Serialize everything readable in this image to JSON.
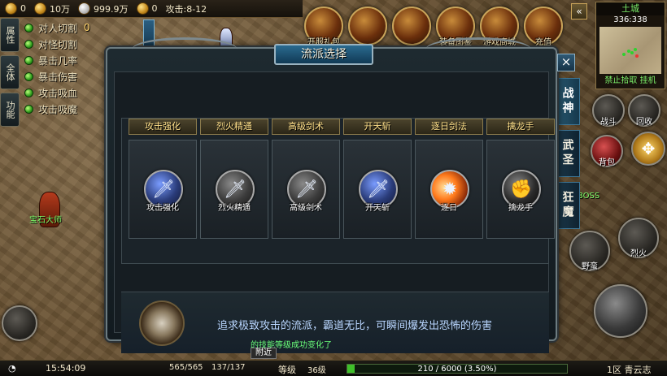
{
  "currency": [
    {
      "icon": "coin-icon",
      "value": "0"
    },
    {
      "icon": "coin-icon",
      "value": "10万"
    },
    {
      "icon": "silver-coin-icon",
      "value": "999.9万"
    },
    {
      "icon": "coin-icon",
      "value": "0"
    }
  ],
  "attack_speed": "攻击:8-12",
  "side_tabs": [
    "属性",
    "全体",
    "功能"
  ],
  "stats": [
    {
      "label": "对人切割",
      "value": "0"
    },
    {
      "label": "对怪切割",
      "value": ""
    },
    {
      "label": "暴击几率",
      "value": ""
    },
    {
      "label": "暴击伤害",
      "value": ""
    },
    {
      "label": "攻击吸血",
      "value": ""
    },
    {
      "label": "攻击吸魔",
      "value": ""
    }
  ],
  "top_icons": [
    "开服礼包",
    "",
    "",
    "装备图鉴",
    "游戏商城",
    "充值"
  ],
  "minimap": {
    "title": "土城",
    "coords": "336:338",
    "footer": "禁止拾取 挂机"
  },
  "dialog": {
    "title": "流派选择",
    "close": "×",
    "skills": [
      {
        "name": "攻击强化",
        "label": "攻击强化",
        "icon": "sword-enhance-icon",
        "variant": "blue"
      },
      {
        "name": "烈火精通",
        "label": "烈火精通",
        "icon": "flame-blade-icon",
        "variant": ""
      },
      {
        "name": "高级剑术",
        "label": "高级剑术",
        "icon": "sword-icon",
        "variant": ""
      },
      {
        "name": "开天斩",
        "label": "开天斩",
        "icon": "heaven-slash-icon",
        "variant": "blue"
      },
      {
        "name": "逐日剑法",
        "label": "逐日",
        "icon": "sun-chase-icon",
        "variant": "fire"
      },
      {
        "name": "擒龙手",
        "label": "擒龙手",
        "icon": "dragon-grab-icon",
        "variant": "shadow"
      }
    ],
    "description": "追求极致攻击的流派，霸道无比，可瞬间爆发出恐怖的伤害"
  },
  "class_tabs": [
    {
      "label": "战神",
      "active": true
    },
    {
      "label": "武圣",
      "active": false
    },
    {
      "label": "狂魔",
      "active": false
    }
  ],
  "right_buttons": {
    "bag": "背包",
    "skill1": "野蛮",
    "skill2": "烈火",
    "boss": "野外BOSS",
    "recycle": "回收",
    "battle": "战斗"
  },
  "npc": "宝石大师",
  "chat": {
    "message": "的技能等级成功变化了",
    "nearby": "附近"
  },
  "bottom": {
    "time": "15:54:09",
    "hp": "565/565",
    "mp": "137/137",
    "level_label": "等级",
    "level": "36级",
    "exp": "210 / 6000 (3.50%)",
    "exp_fraction": 0.035,
    "server": "1区 青云志"
  }
}
